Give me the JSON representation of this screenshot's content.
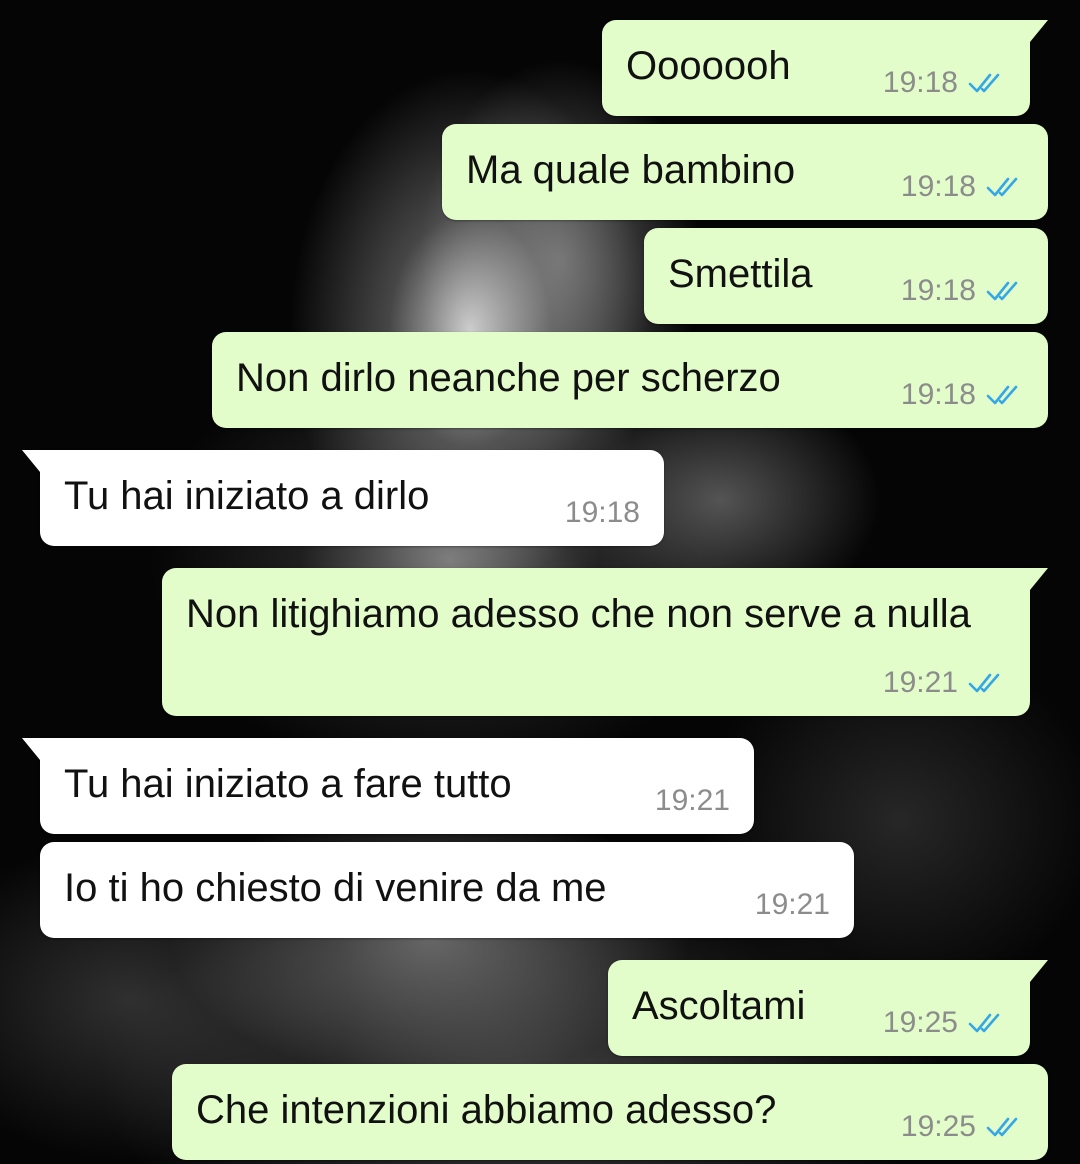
{
  "colors": {
    "outgoing_bubble": "#e2fdca",
    "incoming_bubble": "#ffffff",
    "read_ticks": "#34a7e6",
    "timestamp": "#8c8c8c"
  },
  "messages": [
    {
      "direction": "out",
      "text": "Ooooooh",
      "time": "19:18",
      "status": "read",
      "tail": true
    },
    {
      "direction": "out",
      "text": "Ma quale bambino",
      "time": "19:18",
      "status": "read",
      "tail": false
    },
    {
      "direction": "out",
      "text": "Smettila",
      "time": "19:18",
      "status": "read",
      "tail": false
    },
    {
      "direction": "out",
      "text": "Non dirlo neanche per scherzo",
      "time": "19:18",
      "status": "read",
      "tail": false
    },
    {
      "direction": "in",
      "text": "Tu hai iniziato a dirlo",
      "time": "19:18",
      "tail": true
    },
    {
      "direction": "out",
      "text": "Non litighiamo adesso che non serve a nulla",
      "time": "19:21",
      "status": "read",
      "tail": true
    },
    {
      "direction": "in",
      "text": "Tu hai iniziato a fare tutto",
      "time": "19:21",
      "tail": true
    },
    {
      "direction": "in",
      "text": "Io ti ho chiesto di venire da me",
      "time": "19:21",
      "tail": false
    },
    {
      "direction": "out",
      "text": "Ascoltami",
      "time": "19:25",
      "status": "read",
      "tail": true
    },
    {
      "direction": "out",
      "text": "Che intenzioni abbiamo adesso?",
      "time": "19:25",
      "status": "read",
      "tail": false
    }
  ]
}
